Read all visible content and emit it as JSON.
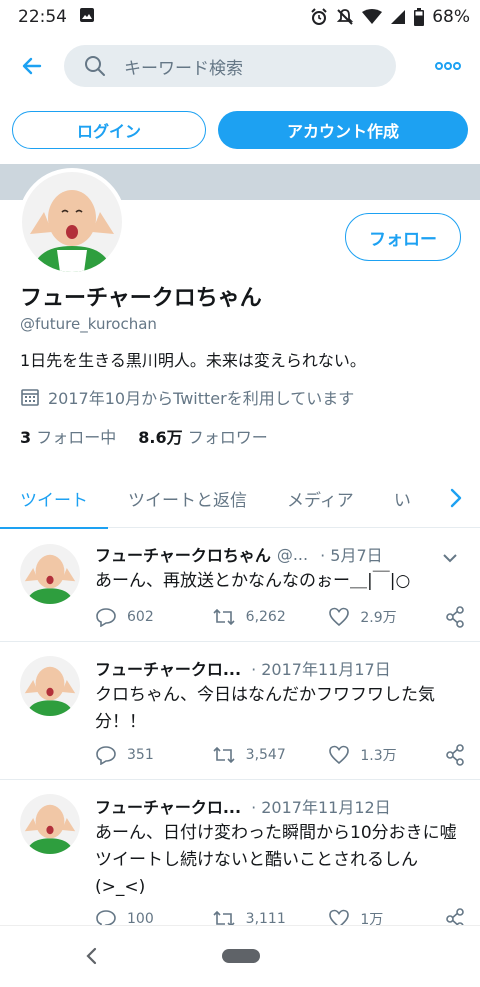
{
  "status_bar": {
    "time": "22:54",
    "battery": "68%",
    "icons": [
      "image-icon",
      "alarm-icon",
      "mute-icon",
      "wifi-icon",
      "signal-icon",
      "battery-icon"
    ]
  },
  "search": {
    "placeholder": "キーワード検索"
  },
  "auth": {
    "login_label": "ログイン",
    "signup_label": "アカウント作成"
  },
  "profile": {
    "follow_label": "フォロー",
    "display_name": "フューチャークロちゃん",
    "handle": "@future_kurochan",
    "bio": "1日先を生きる黒川明人。未来は変えられない。",
    "joined": "2017年10月からTwitterを利用しています",
    "following_count": "3",
    "following_label": "フォロー中",
    "followers_count": "8.6万",
    "followers_label": "フォロワー"
  },
  "tabs": [
    {
      "label": "ツイート",
      "active": true
    },
    {
      "label": "ツイートと返信",
      "active": false
    },
    {
      "label": "メディア",
      "active": false
    },
    {
      "label": "い",
      "active": false
    }
  ],
  "tweets": [
    {
      "name": "フューチャークロちゃん",
      "handle": "@...",
      "date": "· 5月7日",
      "text": "あーん、再放送とかなんなのぉー＿|￣|○",
      "replies": "602",
      "retweets": "6,262",
      "likes": "2.9万"
    },
    {
      "name": "フューチャークロ...",
      "handle": "",
      "date": "· 2017年11月17日",
      "text": "クロちゃん、今日はなんだかフワフワした気分！！",
      "replies": "351",
      "retweets": "3,547",
      "likes": "1.3万"
    },
    {
      "name": "フューチャークロ...",
      "handle": "",
      "date": "· 2017年11月12日",
      "text": "あーん、日付け変わった瞬間から10分おきに嘘ツイートし続けないと酷いことされるしん(>_<)",
      "replies": "100",
      "retweets": "3,111",
      "likes": "1万"
    }
  ],
  "colors": {
    "accent": "#1da1f2",
    "banner": "#ccd6dd",
    "secondary_text": "#657786",
    "primary_text": "#14171a"
  }
}
